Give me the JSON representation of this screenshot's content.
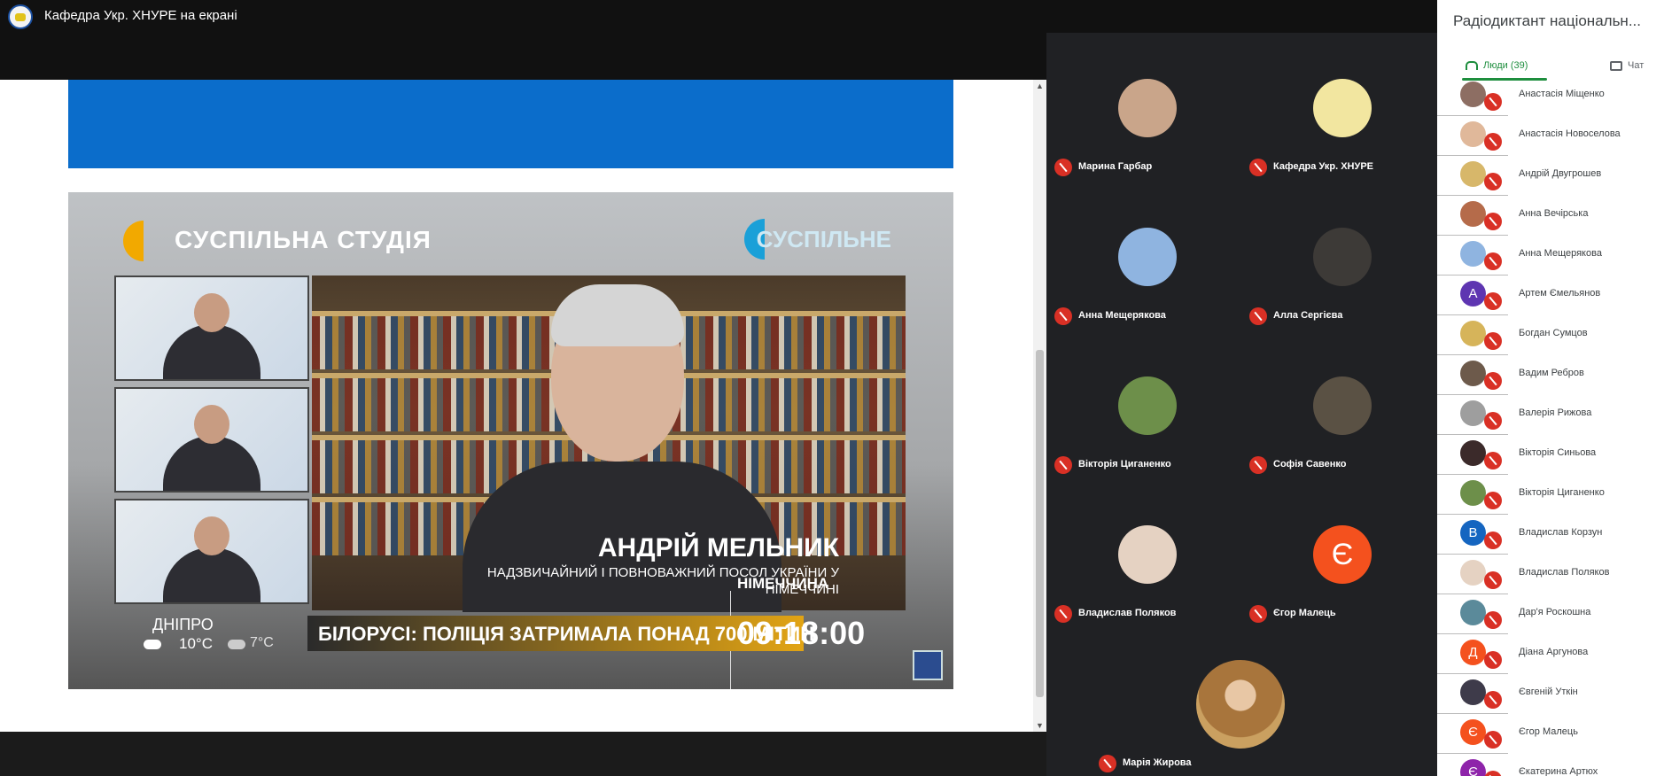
{
  "header": {
    "title": "Кафедра Укр. ХНУРЕ на екрані"
  },
  "video": {
    "brand_left": "СУСПІЛЬНА СТУДІЯ",
    "brand_right": "СУСПІЛЬНЕ",
    "speaker_name": "АНДРІЙ МЕЛЬНИК",
    "speaker_title_line1": "НАДЗВИЧАЙНИЙ І ПОВНОВАЖНИЙ ПОСОЛ УКРАЇНИ У",
    "speaker_title_line2": "НІМЕЧЧИНІ",
    "country": "НІМЕЧЧИНА",
    "ticker": "БІЛОРУСІ: ПОЛІЦІЯ ЗАТРИМАЛА ПОНАД 700 МІТИН",
    "clock": "09:18:00",
    "city": "ДНІПРО",
    "temp_day": "10°C",
    "temp_night": "7°C"
  },
  "grid": {
    "tiles": [
      {
        "name": "Марина Гарбар",
        "color": "#c9a58a"
      },
      {
        "name": "Кафедра Укр. ХНУРЕ",
        "color": "#f2e6a0"
      },
      {
        "name": "Анна Мещерякова",
        "color": "#8fb4e0"
      },
      {
        "name": "Алла Сергієва",
        "color": "#3d3a37"
      },
      {
        "name": "Вікторія Циганенко",
        "color": "#6d8f4a"
      },
      {
        "name": "Софія Савенко",
        "color": "#5a5144"
      },
      {
        "name": "Владислав Поляков",
        "color": "#e5d2c2"
      },
      {
        "name": "Єгор Малець",
        "color": "#f4511e",
        "letter": "Є"
      }
    ],
    "bottom_tile": {
      "name": "Марія Жирова"
    }
  },
  "panel": {
    "title": "Радіодиктант національн...",
    "tab_people": "Люди (39)",
    "tab_chat": "Чат",
    "participants": [
      {
        "name": "Анастасія Міщенко",
        "color": "#8d6e63",
        "letter": ""
      },
      {
        "name": "Анастасія Новоселова",
        "color": "#e0b89a",
        "letter": ""
      },
      {
        "name": "Андрій Двугрошев",
        "color": "#d7b76a",
        "letter": ""
      },
      {
        "name": "Анна Вечірська",
        "color": "#b56b4a",
        "letter": ""
      },
      {
        "name": "Анна Мещерякова",
        "color": "#8fb4e0",
        "letter": ""
      },
      {
        "name": "Артем Ємельянов",
        "color": "#5e35b1",
        "letter": "А"
      },
      {
        "name": "Богдан Сумцов",
        "color": "#d6b45a",
        "letter": ""
      },
      {
        "name": "Вадим Ребров",
        "color": "#6d5a4b",
        "letter": ""
      },
      {
        "name": "Валерія Рижова",
        "color": "#9e9e9e",
        "letter": ""
      },
      {
        "name": "Вікторія Синьова",
        "color": "#3b2a2a",
        "letter": ""
      },
      {
        "name": "Вікторія Циганенко",
        "color": "#6d8f4a",
        "letter": ""
      },
      {
        "name": "Владислав Корзун",
        "color": "#1565c0",
        "letter": "В"
      },
      {
        "name": "Владислав Поляков",
        "color": "#e5d2c2",
        "letter": ""
      },
      {
        "name": "Дар'я Роскошна",
        "color": "#5b8a9a",
        "letter": ""
      },
      {
        "name": "Діана Аргунова",
        "color": "#f4511e",
        "letter": "Д"
      },
      {
        "name": "Євгеній Уткін",
        "color": "#3e3b4a",
        "letter": ""
      },
      {
        "name": "Єгор Малець",
        "color": "#f4511e",
        "letter": "Є"
      },
      {
        "name": "Єкатерина Артюх",
        "color": "#8e24aa",
        "letter": "Є"
      }
    ]
  }
}
